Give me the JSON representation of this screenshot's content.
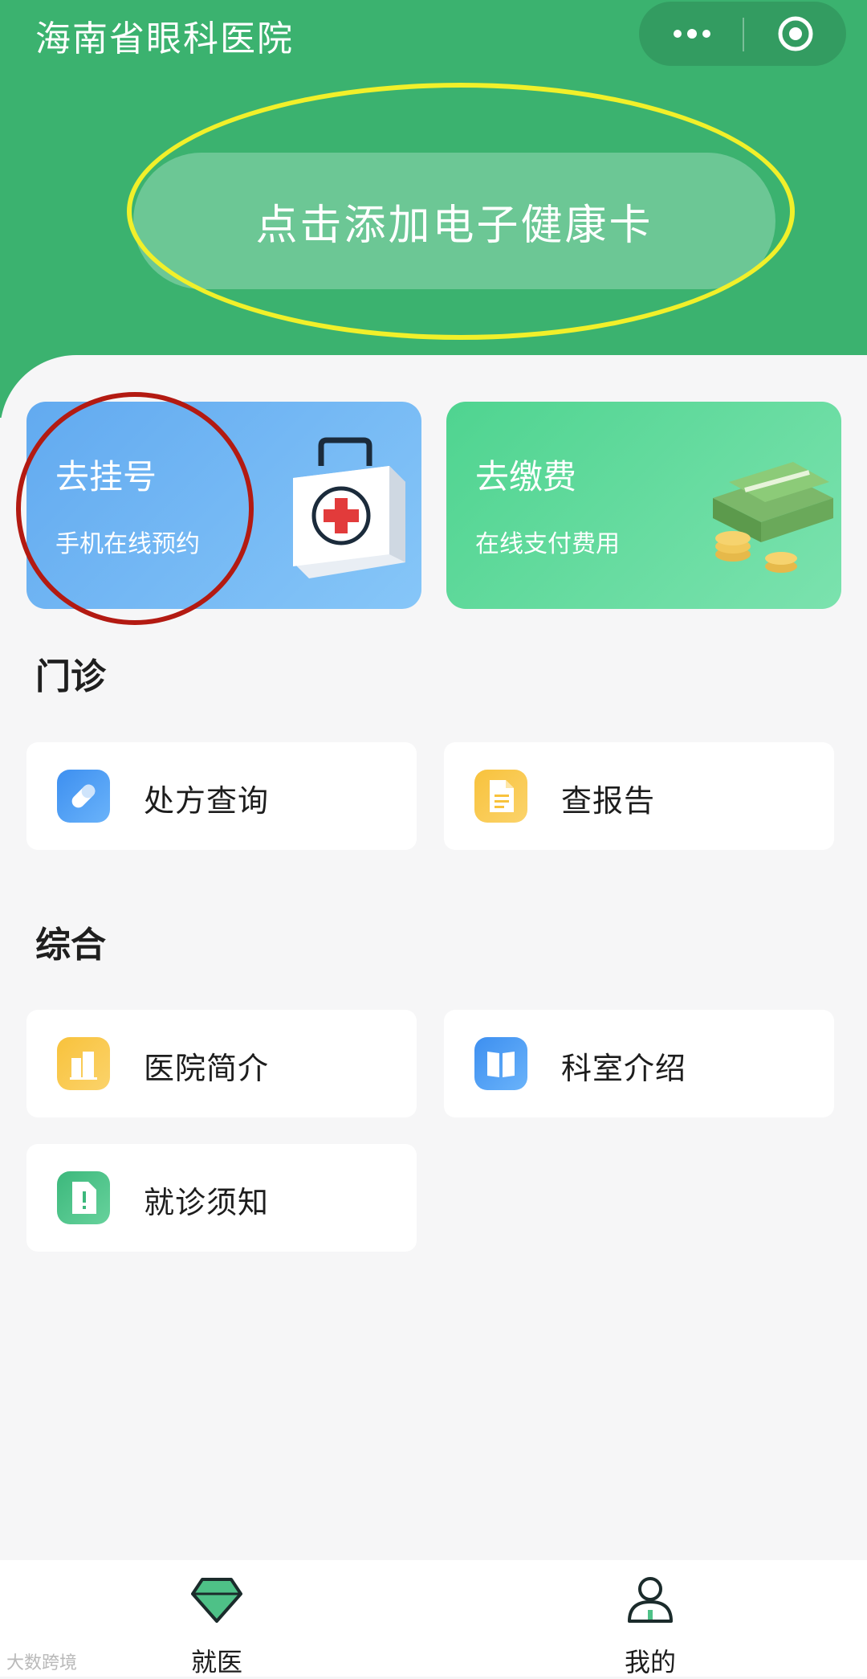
{
  "header": {
    "title": "海南省眼科医院",
    "add_card_label": "点击添加电子健康卡",
    "more_icon": "more-dots-icon",
    "close_icon": "target-close-icon"
  },
  "quick_cards": [
    {
      "title": "去挂号",
      "subtitle": "手机在线预约",
      "icon": "medical-kit-icon"
    },
    {
      "title": "去缴费",
      "subtitle": "在线支付费用",
      "icon": "money-stack-icon"
    }
  ],
  "sections": {
    "outpatient": {
      "title": "门诊",
      "items": [
        {
          "label": "处方查询",
          "icon": "pill-icon"
        },
        {
          "label": "查报告",
          "icon": "document-icon"
        }
      ]
    },
    "general": {
      "title": "综合",
      "items": [
        {
          "label": "医院简介",
          "icon": "building-icon"
        },
        {
          "label": "科室介绍",
          "icon": "book-icon"
        },
        {
          "label": "就诊须知",
          "icon": "notice-icon"
        }
      ]
    }
  },
  "tabbar": {
    "items": [
      {
        "label": "就医",
        "icon": "diamond-icon",
        "active": true
      },
      {
        "label": "我的",
        "icon": "person-icon",
        "active": false
      }
    ]
  },
  "watermark": "大数跨境",
  "colors": {
    "brand_green": "#3bb26f",
    "annotation_yellow": "#f1f02a",
    "annotation_red": "#b31a12"
  }
}
